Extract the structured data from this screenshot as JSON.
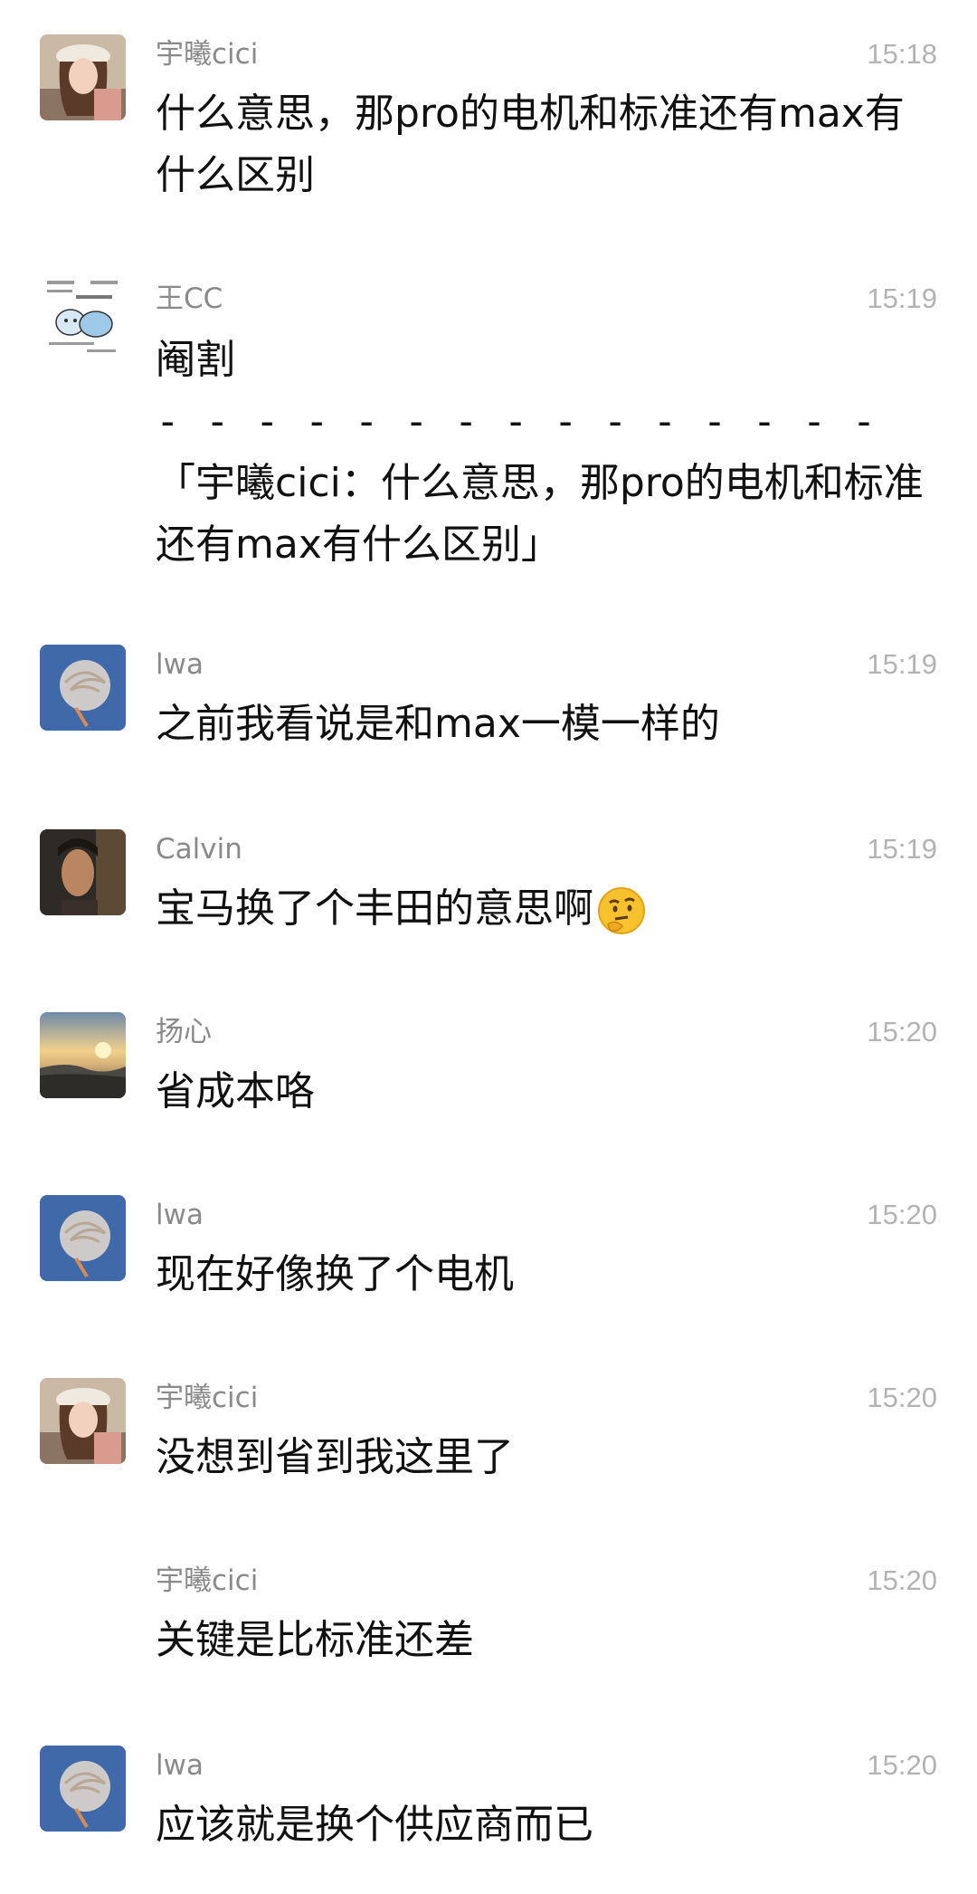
{
  "messages": [
    {
      "sender": "宇曦cici",
      "time": "15:18",
      "text": "什么意思，那pro的电机和标准还有max有什么区别",
      "avatar": "woman-with-cap-avatar"
    },
    {
      "sender": "王CC",
      "time": "15:19",
      "text": "阉割",
      "separator": "- - - - - - - - - - - - - - -",
      "quote": "「宇曦cici：什么意思，那pro的电机和标准还有max有什么区别」",
      "avatar": "cartoon-sticker-avatar"
    },
    {
      "sender": "lwa",
      "time": "15:19",
      "text": "之前我看说是和max一模一样的",
      "avatar": "blue-swirl-avatar"
    },
    {
      "sender": "Calvin",
      "time": "15:19",
      "text": "宝马换了个丰田的意思啊",
      "emoji": "thinking-face-emoji",
      "avatar": "man-portrait-avatar"
    },
    {
      "sender": "扬心",
      "time": "15:20",
      "text": "省成本咯",
      "avatar": "sunrise-landscape-avatar"
    },
    {
      "sender": "lwa",
      "time": "15:20",
      "text": "现在好像换了个电机",
      "avatar": "blue-swirl-avatar"
    },
    {
      "sender": "宇曦cici",
      "time": "15:20",
      "text": "没想到省到我这里了",
      "avatar": "woman-with-cap-avatar"
    },
    {
      "sender": "宇曦cici",
      "time": "15:20",
      "text": "关键是比标准还差"
    },
    {
      "sender": "lwa",
      "time": "15:20",
      "text": "应该就是换个供应商而已",
      "avatar": "blue-swirl-avatar"
    }
  ]
}
